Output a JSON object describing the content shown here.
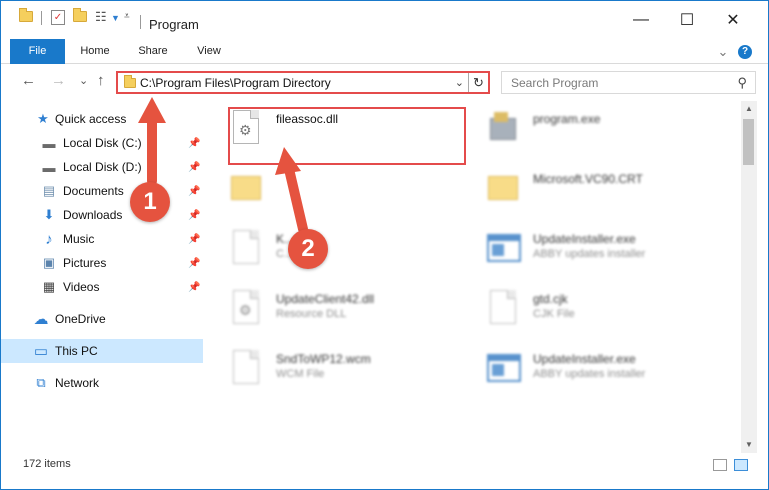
{
  "window": {
    "title": "Program",
    "minimize": "—",
    "maximize": "☐",
    "close": "✕"
  },
  "ribbon": {
    "tabs": [
      {
        "label": "File"
      },
      {
        "label": "Home"
      },
      {
        "label": "Share"
      },
      {
        "label": "View"
      }
    ],
    "expand": "⌄",
    "help": "?"
  },
  "nav": {
    "back": "←",
    "forward": "→",
    "recent": "⌄",
    "up": "↑",
    "address": "C:\\Program Files\\Program Directory",
    "address_chevron": "⌄",
    "refresh": "↻",
    "search_placeholder": "Search Program",
    "search_icon": "⚲"
  },
  "sidebar": {
    "items": [
      {
        "label": "Quick access",
        "icon": "star-icon",
        "glyph": "★",
        "color": "#2f7fd1"
      },
      {
        "label": "Local Disk (C:)",
        "icon": "drive-icon",
        "glyph": "▬",
        "color": "#6b6b6b"
      },
      {
        "label": "Local Disk (D:)",
        "icon": "drive-icon",
        "glyph": "▬",
        "color": "#6b6b6b"
      },
      {
        "label": "Documents",
        "icon": "documents-icon",
        "glyph": "▤",
        "color": "#6f8fae"
      },
      {
        "label": "Downloads",
        "icon": "download-icon",
        "glyph": "⬇",
        "color": "#2f7fd1"
      },
      {
        "label": "Music",
        "icon": "music-icon",
        "glyph": "♪",
        "color": "#2f7fd1"
      },
      {
        "label": "Pictures",
        "icon": "pictures-icon",
        "glyph": "▣",
        "color": "#5c84ad"
      },
      {
        "label": "Videos",
        "icon": "videos-icon",
        "glyph": "▦",
        "color": "#444444"
      },
      {
        "label": "OneDrive",
        "icon": "cloud-icon",
        "glyph": "☁",
        "color": "#2f7fd1"
      },
      {
        "label": "This PC",
        "icon": "computer-icon",
        "glyph": "▭",
        "color": "#2f7fd1"
      },
      {
        "label": "Network",
        "icon": "network-icon",
        "glyph": "⧉",
        "color": "#2f7fd1"
      }
    ],
    "pin_glyph": "📌"
  },
  "files": [
    {
      "name": "fileassoc.dll",
      "desc": "",
      "type": "dll"
    },
    {
      "name": "program.exe",
      "desc": "",
      "type": "exe-gray"
    },
    {
      "name": "",
      "desc": "",
      "type": "folder"
    },
    {
      "name": "Microsoft.VC90.CRT",
      "desc": "",
      "type": "folder"
    },
    {
      "name": "K...ry.cjk",
      "desc": "C...",
      "type": "doc"
    },
    {
      "name": "UpdateInstaller.exe",
      "desc": "ABBY updates installer",
      "type": "exe"
    },
    {
      "name": "UpdateClient42.dll",
      "desc": "Resource DLL",
      "type": "dll"
    },
    {
      "name": "gtd.cjk",
      "desc": "CJK File",
      "type": "doc"
    },
    {
      "name": "SndToWP12.wcm",
      "desc": "WCM File",
      "type": "doc"
    },
    {
      "name": "UpdateInstaller.exe",
      "desc": "ABBY updates installer",
      "type": "exe"
    }
  ],
  "status": {
    "item_count": "172 items"
  },
  "callouts": [
    "1",
    "2"
  ],
  "colors": {
    "accent": "#1979ca",
    "highlight": "#e44b4b",
    "callout": "#e5533f",
    "selected": "#cce8ff"
  }
}
